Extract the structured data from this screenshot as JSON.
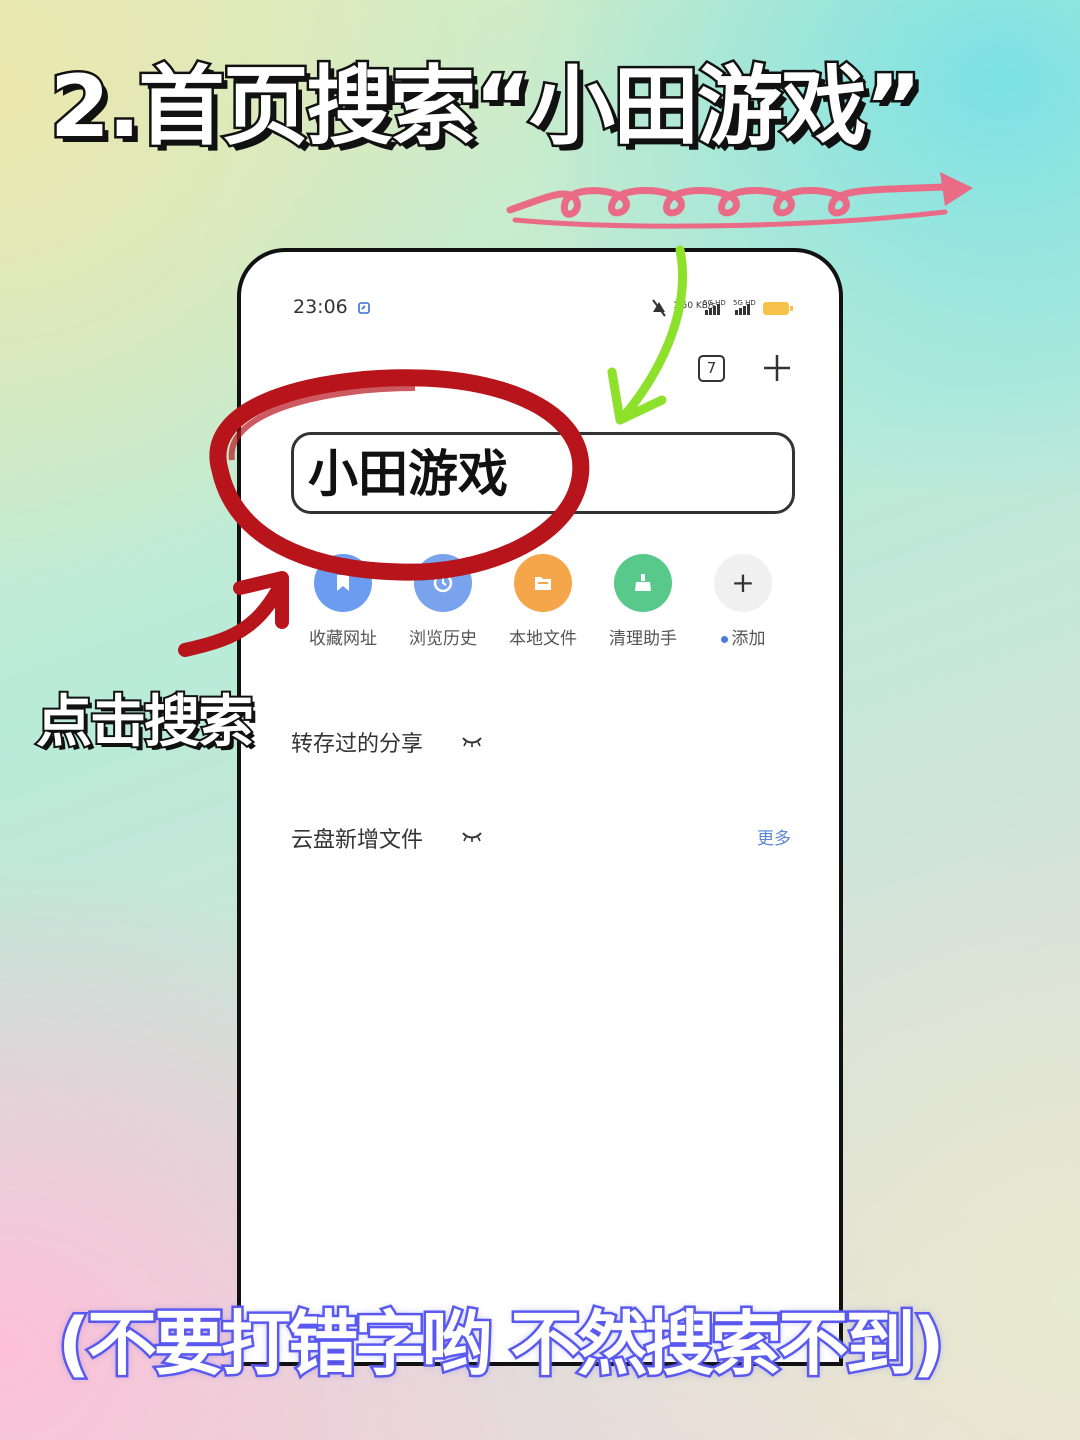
{
  "headline": "2.首页搜索“小田游戏”",
  "status_bar": {
    "time": "23:06",
    "net_speed": "1.50 KB/s",
    "signal_1": "5G HD",
    "signal_2": "5G HD"
  },
  "toolbar": {
    "tab_count": "7",
    "add_tab_icon": "plus-icon"
  },
  "search": {
    "value": "小田游戏"
  },
  "shortcuts": [
    {
      "label": "收藏网址",
      "icon": "bookmark-icon",
      "color": "#6b9cf0"
    },
    {
      "label": "浏览历史",
      "icon": "history-icon",
      "color": "#7aa3ee"
    },
    {
      "label": "本地文件",
      "icon": "folder-icon",
      "color": "#f5a64a"
    },
    {
      "label": "清理助手",
      "icon": "broom-icon",
      "color": "#58c98a"
    },
    {
      "label": "添加",
      "icon": "plus-icon",
      "color": "#f0f0f0"
    }
  ],
  "sections": {
    "saved_shares": "转存过的分享",
    "cloud_new_files": "云盘新增文件",
    "more": "更多"
  },
  "annotations": {
    "tap_search": "点击搜索",
    "warning": "(不要打错字哟 不然搜索不到)"
  },
  "colors": {
    "circle_red": "#b8141c",
    "arrow_green": "#8ee12a",
    "arrow_red": "#b8141c",
    "squiggle_pink": "#ea6b86",
    "warning_stroke": "#5a5af0"
  }
}
